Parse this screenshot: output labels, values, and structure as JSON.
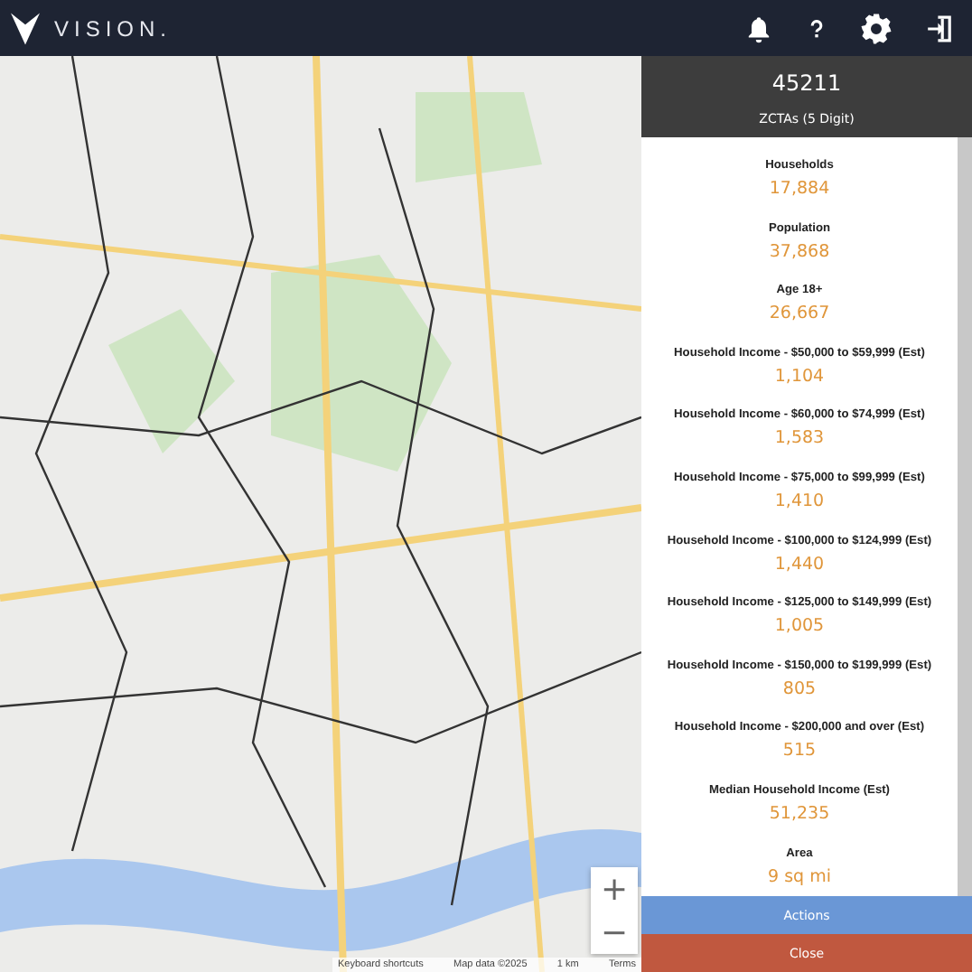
{
  "header": {
    "brand": "VISION.",
    "icons": [
      {
        "kind": "notifications"
      },
      {
        "kind": "help"
      },
      {
        "kind": "settings"
      },
      {
        "kind": "logout"
      }
    ]
  },
  "map": {
    "zoom_in": "+",
    "zoom_out": "−",
    "attribution": [
      "Keyboard shortcuts",
      "Map data ©2025",
      "1 km",
      "Terms"
    ]
  },
  "panel": {
    "title": "45211",
    "subtitle": "ZCTAs (5 Digit)",
    "stats": [
      {
        "label": "Households",
        "value": "17,884"
      },
      {
        "label": "Population",
        "value": "37,868"
      },
      {
        "label": "Age 18+",
        "value": "26,667"
      },
      {
        "label": "Household Income - $50,000 to $59,999 (Est)",
        "value": "1,104"
      },
      {
        "label": "Household Income - $60,000 to $74,999 (Est)",
        "value": "1,583"
      },
      {
        "label": "Household Income - $75,000 to $99,999 (Est)",
        "value": "1,410"
      },
      {
        "label": "Household Income - $100,000 to $124,999 (Est)",
        "value": "1,440"
      },
      {
        "label": "Household Income - $125,000 to $149,999 (Est)",
        "value": "1,005"
      },
      {
        "label": "Household Income - $150,000 to $199,999 (Est)",
        "value": "805"
      },
      {
        "label": "Household Income - $200,000 and over (Est)",
        "value": "515"
      },
      {
        "label": "Median Household Income (Est)",
        "value": "51,235"
      },
      {
        "label": "Area",
        "value": "9 sq mi"
      }
    ],
    "buttons": [
      {
        "label": "Actions",
        "kind": "primary"
      },
      {
        "label": "Close",
        "kind": "danger"
      }
    ]
  }
}
